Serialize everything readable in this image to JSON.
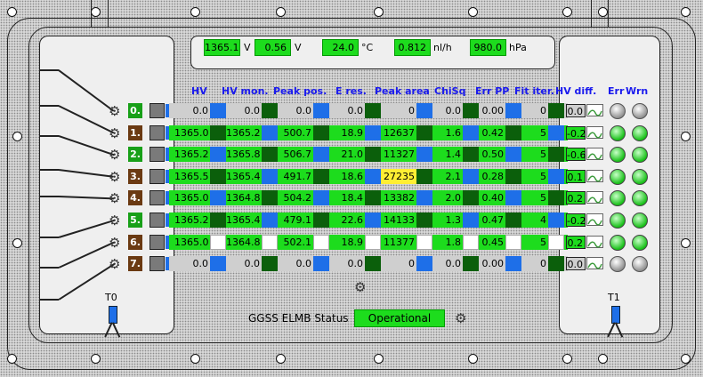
{
  "top_readouts": [
    {
      "value": "1365.1",
      "unit": "V"
    },
    {
      "value": "0.56",
      "unit": "V"
    },
    {
      "value": "24.0",
      "unit": "°C"
    },
    {
      "value": "0.812",
      "unit": "nl/h"
    },
    {
      "value": "980.0",
      "unit": "hPa"
    }
  ],
  "headers": [
    "HV",
    "HV mon.",
    "Peak pos.",
    "E res.",
    "Peak area",
    "ChiSq",
    "Err PP",
    "Fit iter.",
    "HV diff.",
    "Err",
    "Wrn"
  ],
  "channels": [
    {
      "label": "0.",
      "hv": "0.0",
      "hv_mon": "0.0",
      "peak_pos": "0.0",
      "e_res": "0.0",
      "peak_area": "0",
      "chisq": "0.0",
      "err_pp": "0.00",
      "fit_iter": "0",
      "hv_diff": "0.0",
      "state": "off"
    },
    {
      "label": "1.",
      "hv": "1365.0",
      "hv_mon": "1365.2",
      "peak_pos": "500.7",
      "e_res": "18.9",
      "peak_area": "12637",
      "chisq": "1.6",
      "err_pp": "0.42",
      "fit_iter": "5",
      "hv_diff": "-0.2",
      "state": "on"
    },
    {
      "label": "2.",
      "hv": "1365.2",
      "hv_mon": "1365.8",
      "peak_pos": "506.7",
      "e_res": "21.0",
      "peak_area": "11327",
      "chisq": "1.4",
      "err_pp": "0.50",
      "fit_iter": "5",
      "hv_diff": "-0.6",
      "state": "on"
    },
    {
      "label": "3.",
      "hv": "1365.5",
      "hv_mon": "1365.4",
      "peak_pos": "491.7",
      "e_res": "18.6",
      "peak_area": "27235",
      "chisq": "2.1",
      "err_pp": "0.28",
      "fit_iter": "5",
      "hv_diff": "0.1",
      "state": "on"
    },
    {
      "label": "4.",
      "hv": "1365.0",
      "hv_mon": "1364.8",
      "peak_pos": "504.2",
      "e_res": "18.4",
      "peak_area": "13382",
      "chisq": "2.0",
      "err_pp": "0.40",
      "fit_iter": "5",
      "hv_diff": "0.2",
      "state": "on"
    },
    {
      "label": "5.",
      "hv": "1365.2",
      "hv_mon": "1365.4",
      "peak_pos": "479.1",
      "e_res": "22.6",
      "peak_area": "14133",
      "chisq": "1.3",
      "err_pp": "0.47",
      "fit_iter": "4",
      "hv_diff": "-0.2",
      "state": "on"
    },
    {
      "label": "6.",
      "hv": "1365.0",
      "hv_mon": "1364.8",
      "peak_pos": "502.1",
      "e_res": "18.9",
      "peak_area": "11377",
      "chisq": "1.8",
      "err_pp": "0.45",
      "fit_iter": "5",
      "hv_diff": "0.2",
      "state": "on"
    },
    {
      "label": "7.",
      "hv": "0.0",
      "hv_mon": "0.0",
      "peak_pos": "0.0",
      "e_res": "0.0",
      "peak_area": "0",
      "chisq": "0.0",
      "err_pp": "0.00",
      "fit_iter": "0",
      "hv_diff": "0.0",
      "state": "off"
    }
  ],
  "sensors": {
    "left": "T0",
    "right": "T1"
  },
  "status": {
    "label": "GGSS ELMB Status",
    "value": "Operational"
  },
  "colors": {
    "on": "#1ddc1d",
    "off": "#cfcfcf",
    "blue": "#1e6fe8",
    "dark": "#0b5f0b",
    "highlight": "#ffee33",
    "brown": "#6b3a12",
    "channel_green": "#18a018"
  },
  "icons": {
    "gear": "gear-icon",
    "trend": "trend-icon",
    "led": "status-led"
  }
}
